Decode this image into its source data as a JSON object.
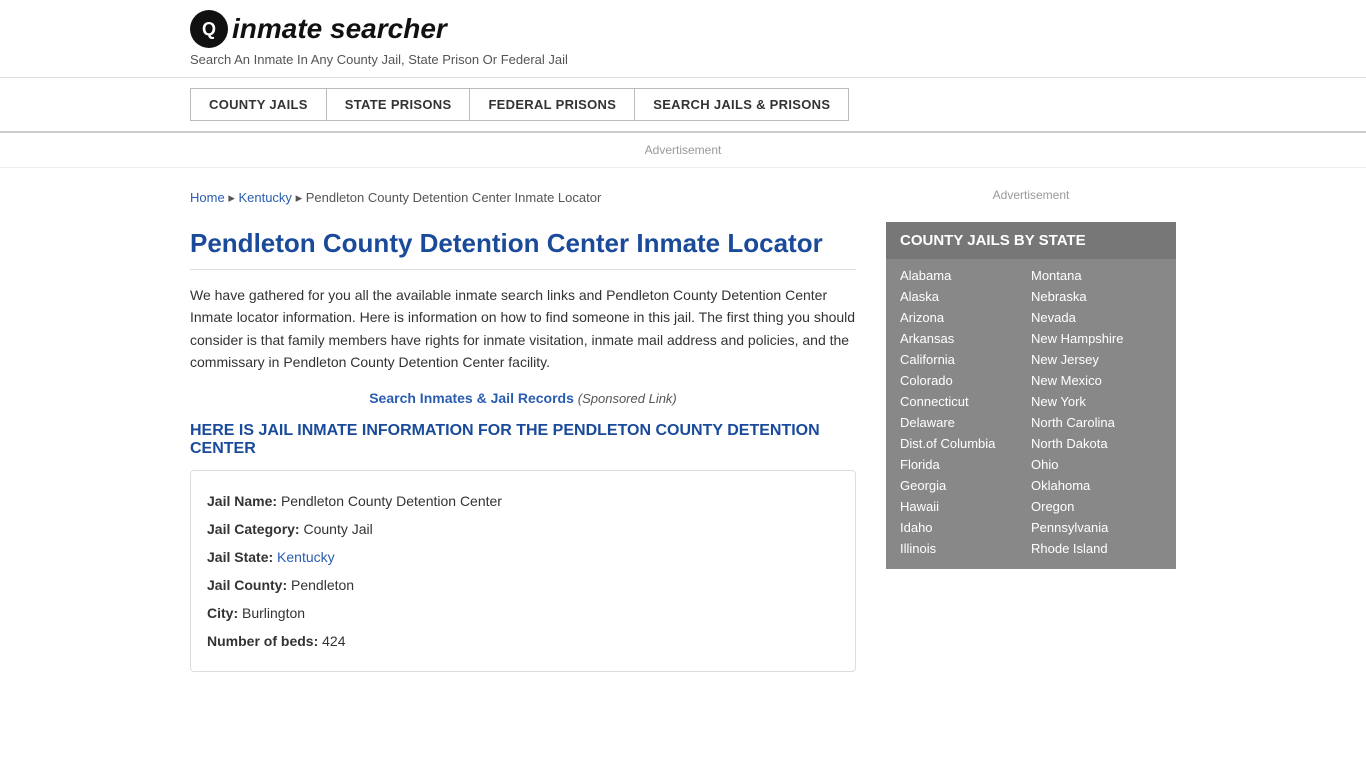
{
  "header": {
    "logo_icon": "🔍",
    "logo_text": "inmate searcher",
    "tagline": "Search An Inmate In Any County Jail, State Prison Or Federal Jail"
  },
  "nav": {
    "buttons": [
      {
        "label": "COUNTY JAILS",
        "name": "county-jails-nav"
      },
      {
        "label": "STATE PRISONS",
        "name": "state-prisons-nav"
      },
      {
        "label": "FEDERAL PRISONS",
        "name": "federal-prisons-nav"
      },
      {
        "label": "SEARCH JAILS & PRISONS",
        "name": "search-jails-nav"
      }
    ]
  },
  "ad_banner": "Advertisement",
  "breadcrumb": {
    "home": "Home",
    "state": "Kentucky",
    "current": "Pendleton County Detention Center Inmate Locator"
  },
  "page_title": "Pendleton County Detention Center Inmate Locator",
  "description": "We have gathered for you all the available inmate search links and Pendleton County Detention Center Inmate locator information. Here is information on how to find someone in this jail. The first thing you should consider is that family members have rights for inmate visitation, inmate mail address and policies, and the commissary in Pendleton County Detention Center facility.",
  "search_link": {
    "text": "Search Inmates & Jail Records",
    "sponsored": "(Sponsored Link)"
  },
  "section_heading": "HERE IS JAIL INMATE INFORMATION FOR THE PENDLETON COUNTY DETENTION CENTER",
  "jail_info": {
    "name_label": "Jail Name:",
    "name_value": "Pendleton County Detention Center",
    "category_label": "Jail Category:",
    "category_value": "County Jail",
    "state_label": "Jail State:",
    "state_value": "Kentucky",
    "county_label": "Jail County:",
    "county_value": "Pendleton",
    "city_label": "City:",
    "city_value": "Burlington",
    "beds_label": "Number of beds:",
    "beds_value": "424"
  },
  "sidebar": {
    "ad_text": "Advertisement",
    "state_list_title": "COUNTY JAILS BY STATE",
    "states_col1": [
      "Alabama",
      "Alaska",
      "Arizona",
      "Arkansas",
      "California",
      "Colorado",
      "Connecticut",
      "Delaware",
      "Dist.of Columbia",
      "Florida",
      "Georgia",
      "Hawaii",
      "Idaho",
      "Illinois"
    ],
    "states_col2": [
      "Montana",
      "Nebraska",
      "Nevada",
      "New Hampshire",
      "New Jersey",
      "New Mexico",
      "New York",
      "North Carolina",
      "North Dakota",
      "Ohio",
      "Oklahoma",
      "Oregon",
      "Pennsylvania",
      "Rhode Island"
    ]
  }
}
